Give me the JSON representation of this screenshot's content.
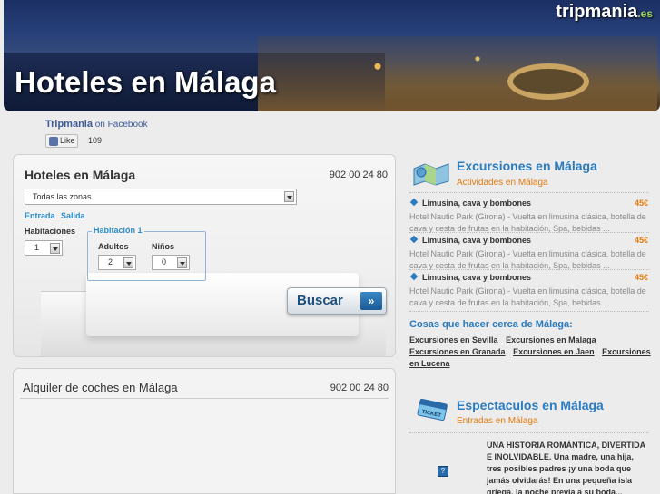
{
  "header": {
    "title": "Hoteles en Málaga",
    "logo_main": "tripmania",
    "logo_suffix": ".es"
  },
  "facebook": {
    "page_name": "Tripmania",
    "on_text": "on Facebook",
    "like_label": "Like",
    "like_count": "109"
  },
  "hotel_search": {
    "title": "Hoteles en Málaga",
    "phone": "902 00 24 80",
    "zone_value": "Todas las zonas",
    "entrada_label": "Entrada",
    "salida_label": "Salida",
    "habitaciones_label": "Habitaciones",
    "habitaciones_value": "1",
    "habitacion_legend": "Habitación 1",
    "adultos_label": "Adultos",
    "adultos_value": "2",
    "ninos_label": "Niños",
    "ninos_value": "0",
    "search_label": "Buscar",
    "search_arrows": "»"
  },
  "car_rental": {
    "title": "Alquiler de coches en Málaga",
    "phone": "902 00 24 80"
  },
  "excursiones": {
    "title": "Excursiones en Málaga",
    "subtitle": "Actividades en Málaga",
    "items": [
      {
        "name": "Limusina, cava y bombones",
        "price": "45€",
        "desc": "Hotel Nautic Park (Girona) - Vuelta en limusina clásica, botella de cava y cesta de frutas en la habitación, Spa, bebidas ..."
      },
      {
        "name": "Limusina, cava y bombones",
        "price": "45€",
        "desc": "Hotel Nautic Park (Girona) - Vuelta en limusina clásica, botella de cava y cesta de frutas en la habitación, Spa, bebidas ..."
      },
      {
        "name": "Limusina, cava y bombones",
        "price": "45€",
        "desc": "Hotel Nautic Park (Girona) - Vuelta en limusina clásica, botella de cava y cesta de frutas en la habitación, Spa, bebidas ..."
      }
    ]
  },
  "cosas": {
    "title": "Cosas que hacer cerca de Málaga:",
    "links": [
      "Excursiones en Sevilla",
      "Excursiones en Malaga",
      "Excursiones en Granada",
      "Excursiones en Jaen",
      "Excursiones en Lucena"
    ]
  },
  "espectaculos": {
    "title": "Espectaculos en Málaga",
    "subtitle": "Entradas en Málaga",
    "ticket_text": "TICKET",
    "description": "UNA HISTORIA ROMÁNTICA, DIVERTIDA E INOLVIDABLE. Una madre, una hija, tres posibles padres ¡y una boda que jamás olvidarás! En una pequeña isla griega, la noche previa a su boda...",
    "mini_icon": "?"
  },
  "icons": {
    "excursiones": "map-icon",
    "espectaculos": "ticket-icon"
  }
}
